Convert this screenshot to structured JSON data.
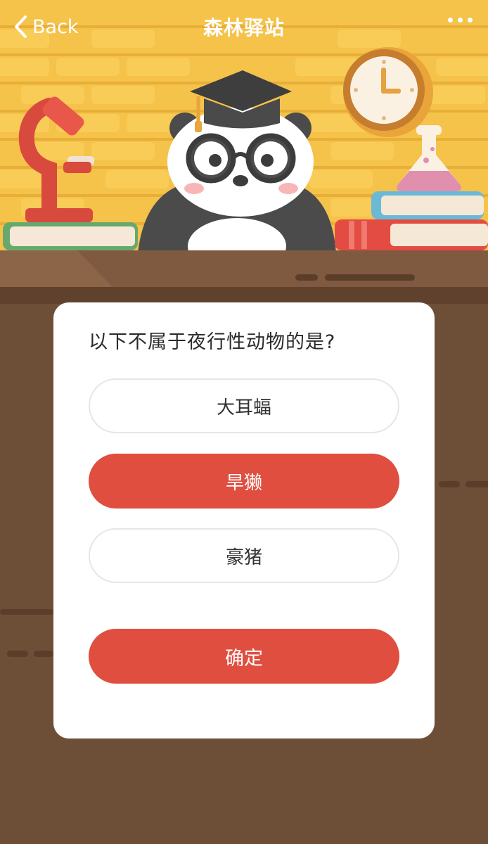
{
  "nav": {
    "back_label": "Back",
    "title": "森林驿站",
    "more_icon": "more-dots-icon"
  },
  "illustration": {
    "character": "panda-graduate-illustration",
    "items": [
      "microscope-icon",
      "clock-icon",
      "flask-icon",
      "books-icon"
    ]
  },
  "quiz": {
    "question": "以下不属于夜行性动物的是?",
    "options": [
      {
        "label": "大耳蝠",
        "selected": false
      },
      {
        "label": "旱獭",
        "selected": true
      },
      {
        "label": "豪猪",
        "selected": false
      }
    ],
    "confirm_label": "确定"
  },
  "colors": {
    "accent": "#e04e3f",
    "wall": "#f5c24a",
    "desk": "#6d4e37"
  }
}
